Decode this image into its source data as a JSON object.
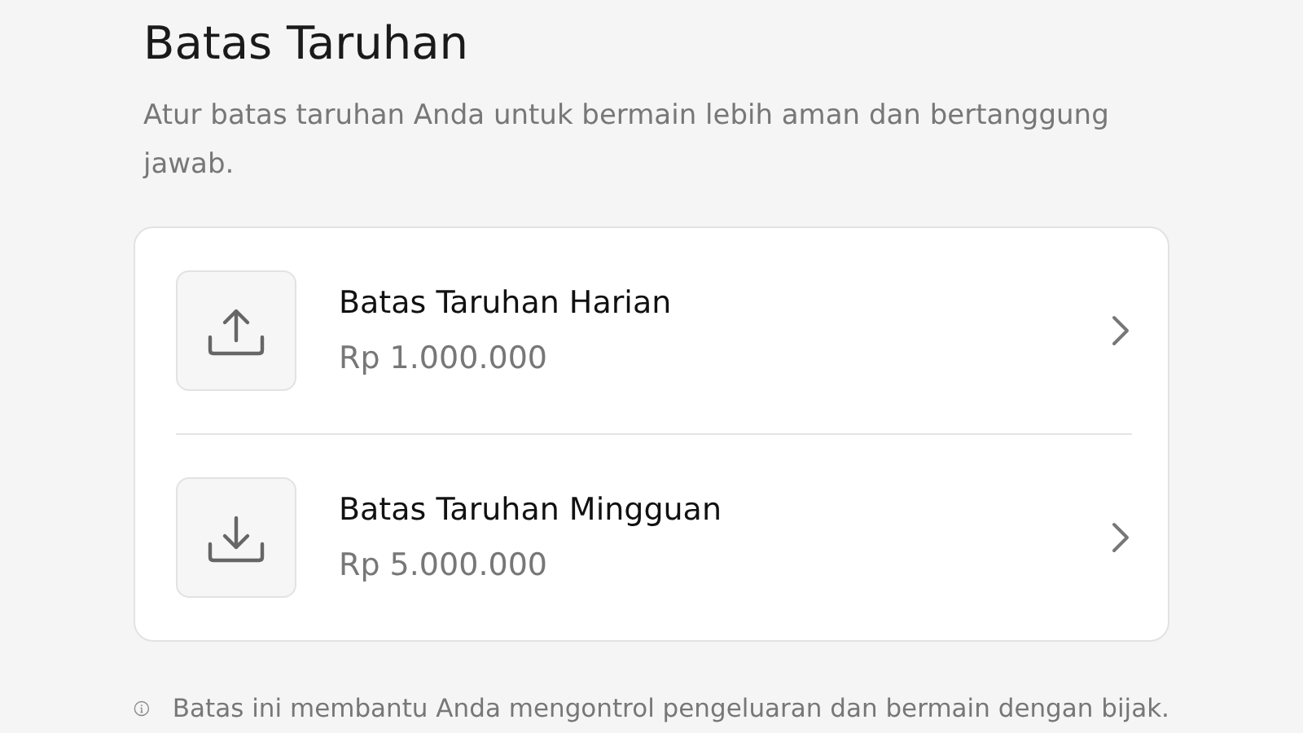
{
  "title": "Batas Taruhan",
  "subtitle": "Atur batas taruhan Anda untuk bermain lebih aman dan bertanggung jawab.",
  "limits": [
    {
      "kind": "upload",
      "label": "Batas Taruhan Harian",
      "amount": "Rp 1.000.000"
    },
    {
      "kind": "download",
      "label": "Batas Taruhan Mingguan",
      "amount": "Rp 5.000.000"
    }
  ],
  "note": "Batas ini membantu Anda mengontrol pengeluaran dan bermain dengan bijak."
}
